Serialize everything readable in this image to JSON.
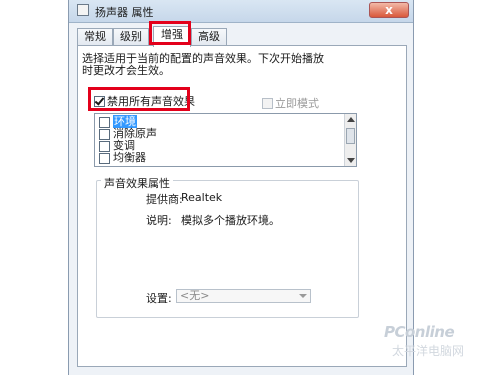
{
  "window": {
    "title": "扬声器 属性",
    "close_label": "x"
  },
  "tabs": [
    {
      "label": "常规"
    },
    {
      "label": "级别"
    },
    {
      "label": "增强"
    },
    {
      "label": "高级"
    }
  ],
  "description": "选择适用于当前的配置的声音效果。下次开始播放时更改才会生效。",
  "disable_all": {
    "label": "禁用所有声音效果",
    "checked": true
  },
  "immediate_mode": {
    "label": "立即模式",
    "checked": false,
    "enabled": false
  },
  "effects": [
    {
      "label": "环境",
      "checked": false,
      "selected": true
    },
    {
      "label": "消除原声",
      "checked": false,
      "selected": false
    },
    {
      "label": "变调",
      "checked": false,
      "selected": false
    },
    {
      "label": "均衡器",
      "checked": false,
      "selected": false
    }
  ],
  "properties": {
    "group_title": "声音效果属性",
    "provider_label": "提供商:",
    "provider_value": "Realtek",
    "description_label": "说明:",
    "description_value": "模拟多个播放环境。",
    "settings_label": "设置:",
    "settings_value": "<无>"
  },
  "watermark": {
    "logo": "PConline",
    "sub": "太平洋电脑网"
  },
  "colors": {
    "highlight": "#e3001b",
    "selection": "#3399ff"
  }
}
